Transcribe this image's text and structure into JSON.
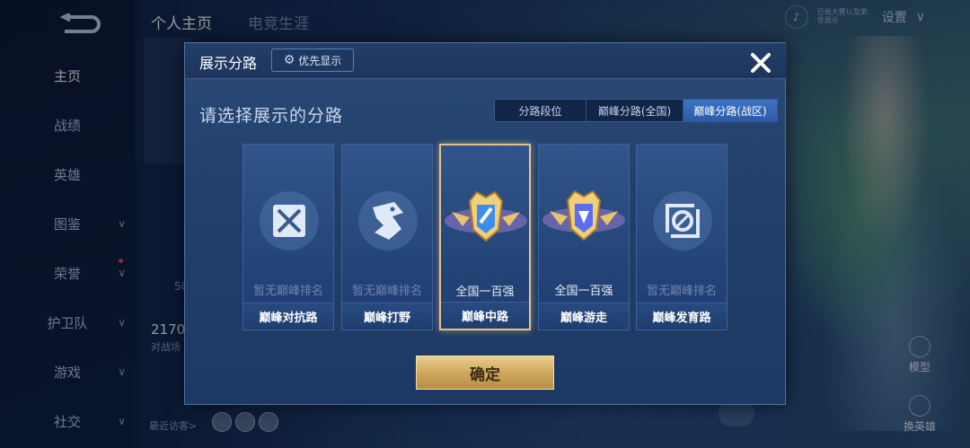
{
  "nav": {
    "items": [
      {
        "label": "主页",
        "has_arrow": false
      },
      {
        "label": "战绩",
        "has_arrow": false
      },
      {
        "label": "英雄",
        "has_arrow": false
      },
      {
        "label": "图鉴",
        "has_arrow": true
      },
      {
        "label": "荣誉",
        "has_arrow": true
      },
      {
        "label": "护卫队",
        "has_arrow": true
      },
      {
        "label": "游戏",
        "has_arrow": true
      },
      {
        "label": "社交",
        "has_arrow": true
      }
    ],
    "arrow_glyph": "∨"
  },
  "top_tabs": [
    "个人主页",
    "电竞生涯"
  ],
  "settings": {
    "label": "设置",
    "tag_text": "已佩大赛以及荣誉展示"
  },
  "background": {
    "stat_number": "2170",
    "stat_sub": "对战场",
    "small_num": "50",
    "visitors_label": "最近访客>",
    "model_label": "模型",
    "swap_hero_label": "换英雄"
  },
  "modal": {
    "title": "展示分路",
    "priority_button": "优先显示",
    "subtitle": "请选择展示的分路",
    "filter_tabs": [
      "分路段位",
      "巅峰分路(全国)",
      "巅峰分路(战区)"
    ],
    "active_filter": 2,
    "lanes": [
      {
        "name": "巅峰对抗路",
        "rank": "暂无巅峰排名",
        "icon": "sword-lane-icon",
        "selected": false
      },
      {
        "name": "巅峰打野",
        "rank": "暂无巅峰排名",
        "icon": "dragon-jungle-icon",
        "selected": false
      },
      {
        "name": "巅峰中路",
        "rank": "全国一百强",
        "icon": "gold-mid-badge-icon",
        "selected": true
      },
      {
        "name": "巅峰游走",
        "rank": "全国一百强",
        "icon": "gold-support-badge-icon",
        "selected": false
      },
      {
        "name": "巅峰发育路",
        "rank": "暂无巅峰排名",
        "icon": "adc-lane-icon",
        "selected": false
      }
    ],
    "confirm_label": "确定"
  },
  "colors": {
    "accent_gold": "#e6c38c",
    "active_tab": "#3e74c4",
    "panel": "#22406b"
  }
}
